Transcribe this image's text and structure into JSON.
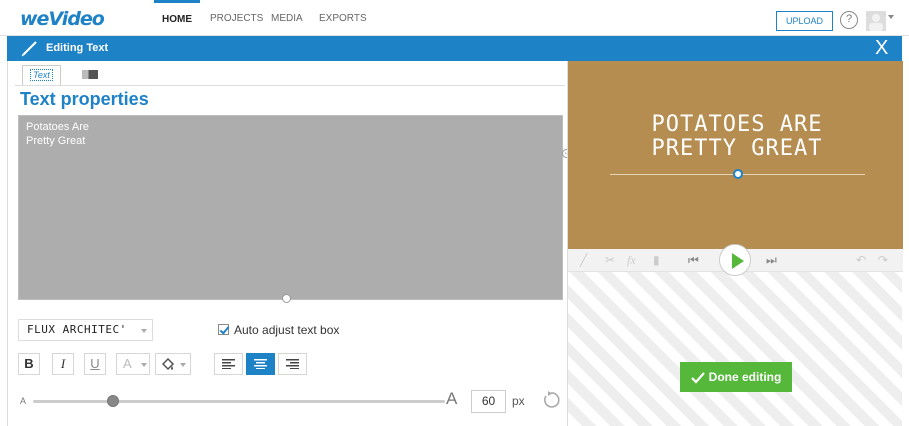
{
  "app": {
    "logo_text": "weVideo",
    "nav": [
      {
        "label": "HOME"
      },
      {
        "label": "PROJECTS"
      },
      {
        "label": "MEDIA"
      },
      {
        "label": "EXPORTS"
      }
    ],
    "upload_label": "UPLOAD",
    "help_glyph": "?",
    "accent_color": "#1e82c7"
  },
  "edit_bar": {
    "title": "Editing Text",
    "close_glyph": "X"
  },
  "tabs": {
    "text_label": "Text"
  },
  "text_properties": {
    "heading": "Text properties",
    "text_value": "Potatoes Are\nPretty Great",
    "font_name": "FLUX ARCHITEC'",
    "auto_adjust_label": "Auto adjust text box",
    "auto_adjust_checked": true,
    "format_buttons": {
      "bold": "B",
      "italic": "I",
      "underline": "U",
      "outline": "A"
    },
    "alignment_selected": "center",
    "size_small_glyph": "A",
    "size_large_glyph": "A",
    "size_value": "60",
    "size_unit": "px"
  },
  "preview": {
    "line1": "POTATOES ARE",
    "line2": "PRETTY GREAT",
    "background_color": "#b58d51"
  },
  "done_button": {
    "label": "Done editing",
    "color": "#55b83a"
  }
}
